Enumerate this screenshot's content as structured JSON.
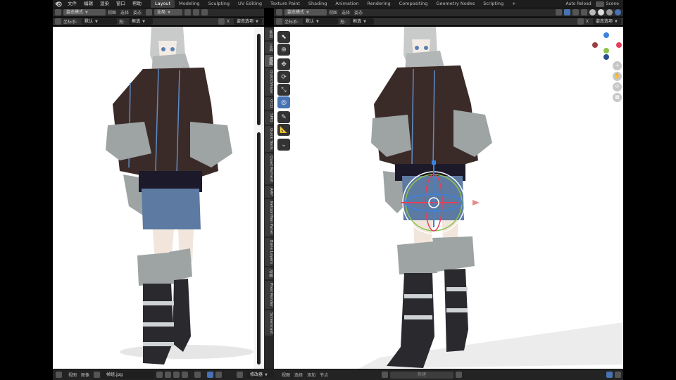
{
  "topbar": {
    "menus": [
      "文件",
      "编辑",
      "渲染",
      "窗口",
      "帮助"
    ],
    "workspaces": [
      "Layout",
      "Modeling",
      "Sculpting",
      "UV Editing",
      "Texture Paint",
      "Shading",
      "Animation",
      "Rendering",
      "Compositing",
      "Geometry Nodes",
      "Scripting"
    ],
    "active_workspace": "Layout",
    "add_tab": "+",
    "auto_reload": "Auto Reload",
    "scene": "Scene"
  },
  "left_header": {
    "mode": "姿态模式",
    "menus": [
      "视图",
      "选择",
      "姿态"
    ],
    "orientation": "全局",
    "coord_label": "坐标系:",
    "coord_value": "默认",
    "drag_label": "拖:",
    "drag_value": "框选",
    "options": "姿态选项",
    "x_label": "X"
  },
  "right_header": {
    "mode": "姿态模式",
    "menus": [
      "视图",
      "选择",
      "姿态"
    ],
    "orientation": "全局",
    "coord_label": "坐标系:",
    "coord_value": "默认",
    "drag_label": "拖:",
    "drag_value": "框选",
    "options": "姿态选项",
    "x_label": "X"
  },
  "sidebar_tabs": [
    "条目",
    "工具",
    "视图",
    "QuickShape",
    "OCD",
    "SPID",
    "Quick Tools",
    "Quad Remesh",
    "ARP",
    "RetoonTool Panel",
    "Bone Layers",
    "动画",
    "Pixel Render",
    "Screencast"
  ],
  "active_sidebar_tab": "视图",
  "tools": [
    "cursor-select",
    "3d-cursor",
    "move",
    "rotate",
    "scale",
    "transform",
    "annotate",
    "measure",
    "bone-envelope"
  ],
  "active_tool": "transform",
  "gizmo": {
    "x_color": "#e3405a",
    "y_color": "#8bc34a",
    "z_color": "#3b82e0",
    "nav_buttons": [
      "+",
      "✋",
      "⟳",
      "▦"
    ]
  },
  "bottom": {
    "left_menus": [
      "视图",
      "图像"
    ],
    "image_name": "帧组.jpg",
    "editor": "修改器",
    "right_menus": [
      "视图",
      "选择",
      "添加",
      "节点"
    ],
    "new_button": "新建"
  }
}
